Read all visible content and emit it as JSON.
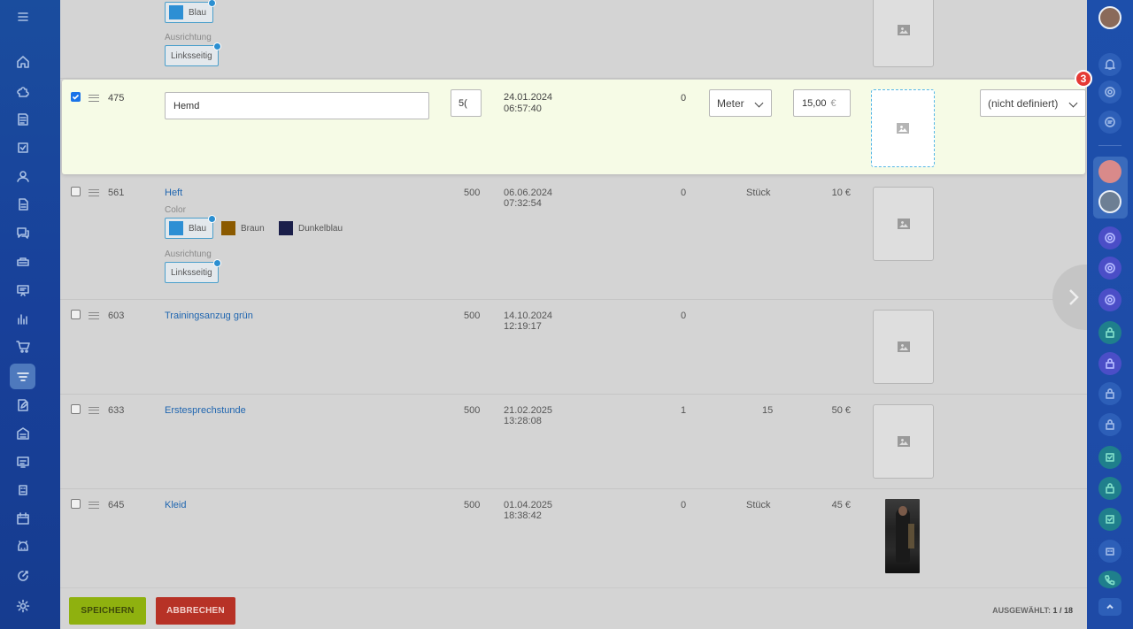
{
  "left_sidebar": {
    "icons": [
      "menu-icon",
      "home-icon",
      "puzzle-icon",
      "tasks-list-icon",
      "checkbox-icon",
      "contacts-icon",
      "document-icon",
      "chat-icon",
      "printer-icon",
      "presentation-icon",
      "analytics-icon",
      "cart-icon",
      "funnel-icon",
      "edit-icon",
      "warehouse-icon",
      "store-icon",
      "robot-icon",
      "calendar-icon",
      "android-icon",
      "target-icon",
      "settings-icon"
    ]
  },
  "right_sidebar": {
    "icons": [
      "user-avatar",
      "bell-icon",
      "ring-icon",
      "chat-icon",
      "logo-icon",
      "user-avatar",
      "ring-icon",
      "ring-icon",
      "ring-icon",
      "lock-icon",
      "lock-icon",
      "lock-icon",
      "lock-icon",
      "checkbox-icon",
      "lock-icon",
      "checkbox-icon",
      "robot-icon",
      "phone-icon",
      "up-icon"
    ],
    "badge": "3"
  },
  "top_partial": {
    "chip_label": "Blau",
    "prop_label": "Ausrichtung",
    "orientation_chip": "Linksseitig"
  },
  "edit_row": {
    "id": "475",
    "name_value": "Hemd",
    "quantity_value": "5(",
    "date": "24.01.2024",
    "time": "06:57:40",
    "reserved": "0",
    "unit_value": "Meter",
    "price_value": "15,00",
    "currency": "€",
    "vat_value": "(nicht definiert)"
  },
  "rows": [
    {
      "id": "561",
      "name": "Heft",
      "quantity": "500",
      "date": "06.06.2024",
      "time": "07:32:54",
      "reserved": "0",
      "unit": "Stück",
      "price": "10 €",
      "props": {
        "color_label": "Color",
        "colors": [
          "Blau",
          "Braun",
          "Dunkelblau"
        ],
        "orientation_label": "Ausrichtung",
        "orientation": "Linksseitig"
      }
    },
    {
      "id": "603",
      "name": "Trainingsanzug grün",
      "quantity": "500",
      "date": "14.10.2024",
      "time": "12:19:17",
      "reserved": "0",
      "unit": "",
      "price": ""
    },
    {
      "id": "633",
      "name": "Erstesprechstunde",
      "quantity": "500",
      "date": "21.02.2025",
      "time": "13:28:08",
      "reserved": "1",
      "unit": "15",
      "price": "50 €"
    },
    {
      "id": "645",
      "name": "Kleid",
      "quantity": "500",
      "date": "01.04.2025",
      "time": "18:38:42",
      "reserved": "0",
      "unit": "Stück",
      "price": "45 €"
    }
  ],
  "footer": {
    "save_label": "SPEICHERN",
    "cancel_label": "ABBRECHEN",
    "selected_label": "AUSGEWÄHLT:",
    "selected_value": "1 / 18"
  },
  "colors": {
    "accent_save": "#8fb10f",
    "accent_cancel": "#b73226",
    "sidebar": "#1a4d9e",
    "edit_row_bg": "#f6fbe6",
    "chip_blau": "#2d8fd4",
    "chip_braun": "#8b5a00",
    "chip_dunkelblau": "#1b1f4a"
  }
}
